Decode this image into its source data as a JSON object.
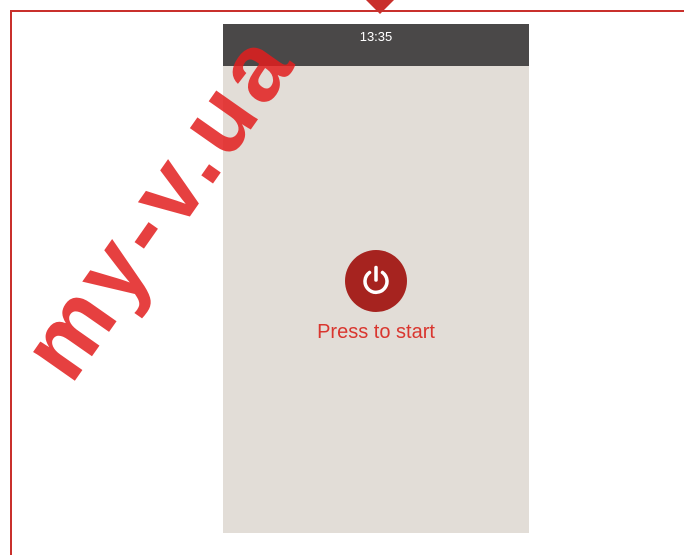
{
  "status_bar": {
    "time": "13:35"
  },
  "power_button": {
    "icon": "power-icon"
  },
  "start_label": "Press to start",
  "watermark": {
    "text": "my-v.ua"
  },
  "colors": {
    "frame": "#c9302c",
    "phone_background": "#e2ddd7",
    "status_bar": "#4a4848",
    "power_button": "#a6231f",
    "label": "#d9362f"
  }
}
